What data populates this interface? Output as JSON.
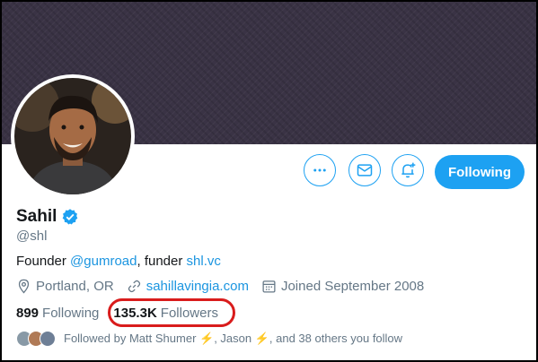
{
  "profile": {
    "name": "Sahil",
    "handle": "@shl",
    "bio": {
      "prefix": "Founder ",
      "mention": "@gumroad",
      "middle": ", funder ",
      "url": "shl.vc"
    },
    "location": "Portland, OR",
    "website": "sahillavingia.com",
    "joined": "Joined September 2008"
  },
  "stats": {
    "following_count": "899",
    "following_label": "Following",
    "followers_count": "135.3K",
    "followers_label": "Followers"
  },
  "buttons": {
    "follow_label": "Following"
  },
  "followed_by": "Followed by Matt Shumer ⚡, Jason ⚡, and 38 others you follow",
  "icons": [
    "more-icon",
    "mail-icon",
    "notification-icon",
    "verified-icon",
    "location-icon",
    "link-icon",
    "calendar-icon"
  ],
  "colors": {
    "accent": "#1da1f2",
    "link": "#1b95e0",
    "highlight": "#d91c1c",
    "banner": "#3a3345"
  }
}
